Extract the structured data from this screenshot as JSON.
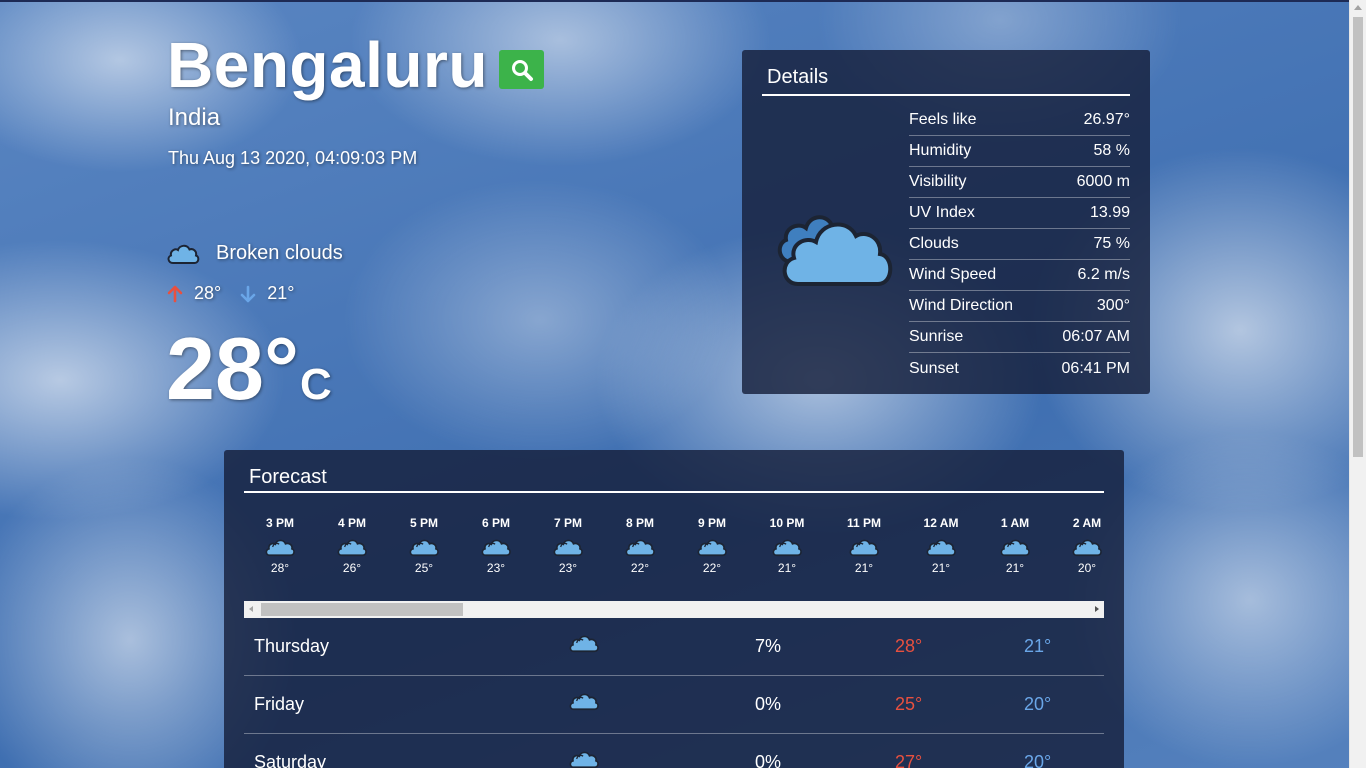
{
  "location": {
    "city": "Bengaluru",
    "country": "India",
    "datetime": "Thu Aug 13 2020, 04:09:03 PM"
  },
  "current": {
    "condition": "Broken clouds",
    "condition_icon": "cloud-icon",
    "high": "28°",
    "low": "21°",
    "temp": "28°",
    "unit": "C"
  },
  "details": {
    "title": "Details",
    "icon": "cloud-icon",
    "rows": [
      {
        "label": "Feels like",
        "value": "26.97°"
      },
      {
        "label": "Humidity",
        "value": "58 %"
      },
      {
        "label": "Visibility",
        "value": "6000 m"
      },
      {
        "label": "UV Index",
        "value": "13.99"
      },
      {
        "label": "Clouds",
        "value": "75 %"
      },
      {
        "label": "Wind Speed",
        "value": "6.2 m/s"
      },
      {
        "label": "Wind Direction",
        "value": "300°"
      },
      {
        "label": "Sunrise",
        "value": "06:07 AM"
      },
      {
        "label": "Sunset",
        "value": "06:41 PM"
      }
    ]
  },
  "forecast": {
    "title": "Forecast",
    "hourly": [
      {
        "time": "3 PM",
        "temp": "28°"
      },
      {
        "time": "4 PM",
        "temp": "26°"
      },
      {
        "time": "5 PM",
        "temp": "25°"
      },
      {
        "time": "6 PM",
        "temp": "23°"
      },
      {
        "time": "7 PM",
        "temp": "23°"
      },
      {
        "time": "8 PM",
        "temp": "22°"
      },
      {
        "time": "9 PM",
        "temp": "22°"
      },
      {
        "time": "10 PM",
        "temp": "21°"
      },
      {
        "time": "11 PM",
        "temp": "21°"
      },
      {
        "time": "12 AM",
        "temp": "21°"
      },
      {
        "time": "1 AM",
        "temp": "21°"
      },
      {
        "time": "2 AM",
        "temp": "20°"
      }
    ],
    "daily": [
      {
        "day": "Thursday",
        "pop": "7%",
        "high": "28°",
        "low": "21°"
      },
      {
        "day": "Friday",
        "pop": "0%",
        "high": "25°",
        "low": "20°"
      },
      {
        "day": "Saturday",
        "pop": "0%",
        "high": "27°",
        "low": "20°"
      }
    ]
  },
  "colors": {
    "search_button": "#3cb34a",
    "high_temp": "#e8503f",
    "low_temp": "#6aa6e8",
    "cloud_fill": "#6fb3e6",
    "cloud_outline": "#1c2433"
  }
}
